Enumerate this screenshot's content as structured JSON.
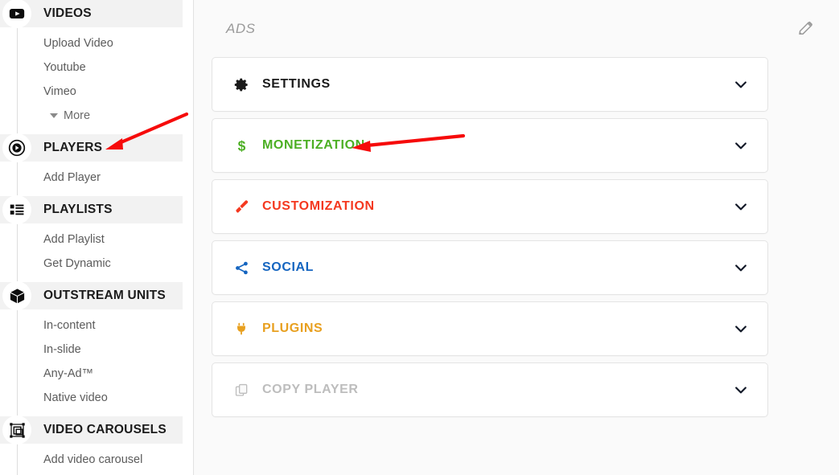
{
  "sidebar": {
    "sections": [
      {
        "label": "VIDEOS",
        "icon": "youtube-play-icon",
        "items": [
          {
            "label": "Upload Video",
            "icon": null
          },
          {
            "label": "Youtube",
            "icon": null
          },
          {
            "label": "Vimeo",
            "icon": null
          },
          {
            "label": "More",
            "icon": "caret-down-icon"
          }
        ]
      },
      {
        "label": "PLAYERS",
        "icon": "circle-play-icon",
        "items": [
          {
            "label": "Add Player",
            "icon": null
          }
        ]
      },
      {
        "label": "PLAYLISTS",
        "icon": "list-icon",
        "items": [
          {
            "label": "Add Playlist",
            "icon": null
          },
          {
            "label": "Get Dynamic",
            "icon": null
          }
        ]
      },
      {
        "label": "OUTSTREAM UNITS",
        "icon": "cube-icon",
        "items": [
          {
            "label": "In-content",
            "icon": null
          },
          {
            "label": "In-slide",
            "icon": null
          },
          {
            "label": "Any-Ad™",
            "icon": null
          },
          {
            "label": "Native video",
            "icon": null
          }
        ]
      },
      {
        "label": "VIDEO CAROUSELS",
        "icon": "carousel-frame-icon",
        "items": [
          {
            "label": "Add video carousel",
            "icon": null
          }
        ]
      }
    ]
  },
  "main": {
    "title": "ADS",
    "edit_icon": "pencil-icon",
    "panels": [
      {
        "label": "SETTINGS",
        "icon": "gear-icon",
        "color": "#1b1b1b",
        "chevron": "chevron-down-icon"
      },
      {
        "label": "MONETIZATION",
        "icon": "dollar-icon",
        "color": "#4caf24",
        "chevron": "chevron-down-icon"
      },
      {
        "label": "CUSTOMIZATION",
        "icon": "paintbrush-icon",
        "color": "#f4381f",
        "chevron": "chevron-down-icon"
      },
      {
        "label": "SOCIAL",
        "icon": "share-icon",
        "color": "#1565c0",
        "chevron": "chevron-down-icon"
      },
      {
        "label": "PLUGINS",
        "icon": "plug-icon",
        "color": "#e8a020",
        "chevron": "chevron-down-icon"
      },
      {
        "label": "COPY PLAYER",
        "icon": "copy-icon",
        "color": "#bdbdbd",
        "chevron": "chevron-down-icon"
      }
    ]
  },
  "annotations": {
    "arrow_color": "#f60b0b",
    "arrows": [
      {
        "name": "arrow-to-players",
        "target": "PLAYERS"
      },
      {
        "name": "arrow-to-monetization",
        "target": "MONETIZATION"
      }
    ]
  }
}
